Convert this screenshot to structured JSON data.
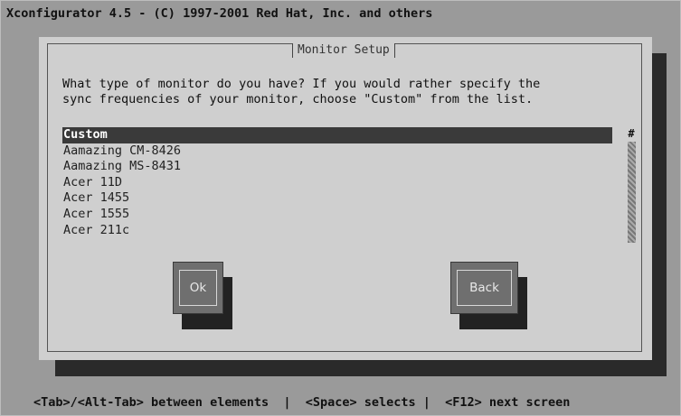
{
  "window": {
    "title": "Xconfigurator 4.5 - (C) 1997-2001 Red Hat, Inc. and others"
  },
  "dialog": {
    "title": "Monitor Setup",
    "prompt_line1": "What type of monitor do you have? If you would rather specify the",
    "prompt_line2": "sync frequencies of your monitor, choose \"Custom\" from the list.",
    "list": {
      "items": [
        {
          "label": "Custom",
          "selected": true
        },
        {
          "label": "Aamazing CM-8426",
          "selected": false
        },
        {
          "label": "Aamazing MS-8431",
          "selected": false
        },
        {
          "label": "Acer 11D",
          "selected": false
        },
        {
          "label": "Acer 1455",
          "selected": false
        },
        {
          "label": "Acer 1555",
          "selected": false
        },
        {
          "label": "Acer 211c",
          "selected": false
        }
      ],
      "scroll_marker": "#"
    },
    "ok_label": "Ok",
    "back_label": "Back"
  },
  "statusbar": {
    "text": "<Tab>/<Alt-Tab> between elements  |  <Space> selects |  <F12> next screen"
  }
}
